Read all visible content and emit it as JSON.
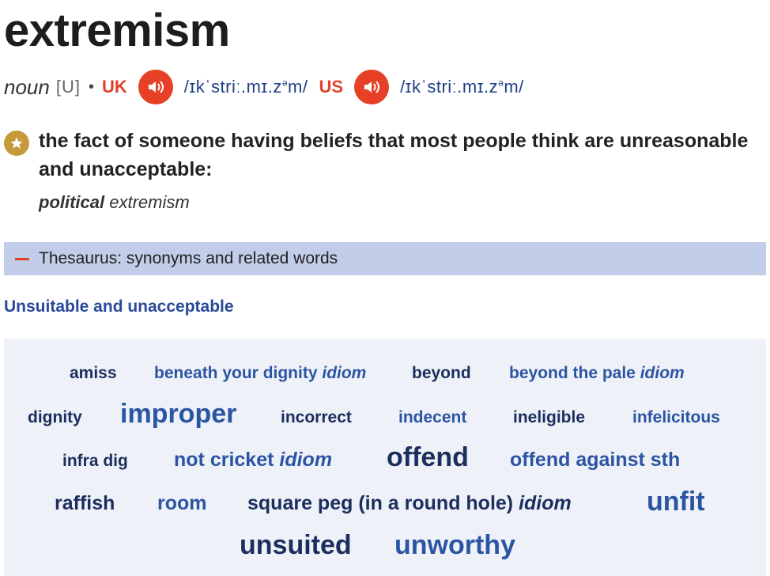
{
  "entry": {
    "headword": "extremism",
    "part_of_speech": "noun",
    "grammar": "[U]",
    "separator": "•",
    "uk": {
      "label": "UK",
      "ipa": "/ɪkˈstriː.mɪ.zᵊm/",
      "audio_icon": "speaker-icon"
    },
    "us": {
      "label": "US",
      "ipa": "/ɪkˈstriː.mɪ.zᵊm/",
      "audio_icon": "speaker-icon"
    }
  },
  "definition": {
    "text": "the fact of someone having beliefs that most people think are unreasonable and unacceptable:",
    "example_bold": "political",
    "example_rest": " extremism"
  },
  "thesaurus": {
    "label": "Thesaurus: synonyms and related words",
    "section_heading": "Unsuitable and unacceptable",
    "words": [
      {
        "text": "amiss",
        "idiom": ""
      },
      {
        "text": "beneath your dignity",
        "idiom": "idiom"
      },
      {
        "text": "beyond",
        "idiom": ""
      },
      {
        "text": "beyond the pale",
        "idiom": "idiom"
      },
      {
        "text": "dignity",
        "idiom": ""
      },
      {
        "text": "improper",
        "idiom": ""
      },
      {
        "text": "incorrect",
        "idiom": ""
      },
      {
        "text": "indecent",
        "idiom": ""
      },
      {
        "text": "ineligible",
        "idiom": ""
      },
      {
        "text": "infelicitous",
        "idiom": ""
      },
      {
        "text": "infra dig",
        "idiom": ""
      },
      {
        "text": "not cricket",
        "idiom": "idiom"
      },
      {
        "text": "offend",
        "idiom": ""
      },
      {
        "text": "offend against sth",
        "idiom": ""
      },
      {
        "text": "raffish",
        "idiom": ""
      },
      {
        "text": "room",
        "idiom": ""
      },
      {
        "text": "square peg (in a round hole)",
        "idiom": "idiom"
      },
      {
        "text": "unfit",
        "idiom": ""
      },
      {
        "text": "unsuited",
        "idiom": ""
      },
      {
        "text": "unworthy",
        "idiom": ""
      }
    ]
  },
  "colors": {
    "accent_red": "#e64027",
    "link_blue": "#2b54a3",
    "link_dark": "#1c2e5e",
    "star_gold": "#c6993a",
    "thesaurus_bar": "#c1cde9",
    "cloud_bg": "#eef1f7"
  }
}
